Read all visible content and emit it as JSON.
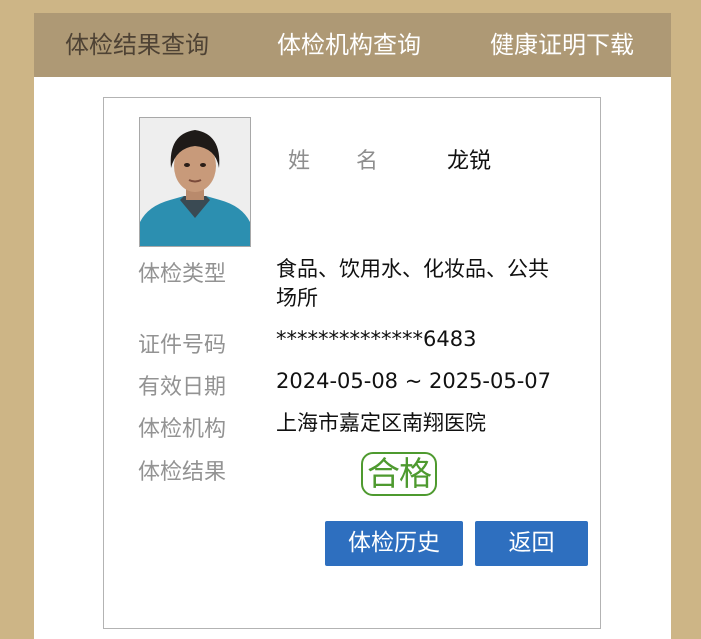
{
  "nav": {
    "tabs": [
      {
        "label": "体检结果查询"
      },
      {
        "label": "体检机构查询"
      },
      {
        "label": "健康证明下载"
      }
    ]
  },
  "record": {
    "name_label_1": "姓",
    "name_label_2": "名",
    "name": "龙锐",
    "type_label": "体检类型",
    "type_value": "食品、饮用水、化妆品、公共场所",
    "id_label": "证件号码",
    "id_value": "**************6483",
    "valid_label": "有效日期",
    "valid_value": "2024-05-08 ~ 2025-05-07",
    "org_label": "体检机构",
    "org_value": "上海市嘉定区南翔医院",
    "result_label": "体检结果",
    "result_value": "合格"
  },
  "actions": {
    "history_label": "体检历史",
    "back_label": "返回"
  },
  "colors": {
    "page_bg": "#cdb586",
    "nav_bg": "#ae9975",
    "button_bg": "#2e6fbf",
    "stamp_green": "#4e9a2f"
  }
}
